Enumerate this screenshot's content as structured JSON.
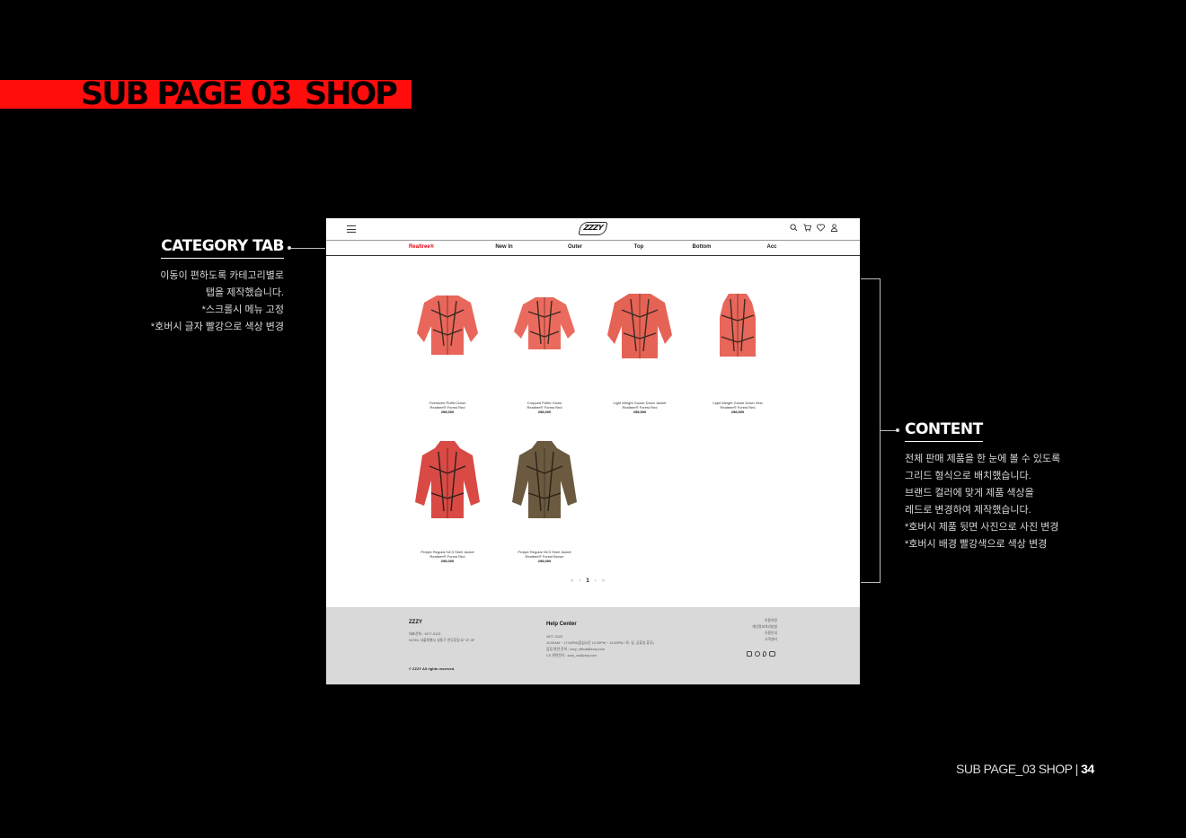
{
  "page": {
    "title": "SUB PAGE 03_SHOP",
    "footer_label": "SUB PAGE_03 SHOP",
    "separator": " | ",
    "page_number": "34",
    "accent_color": "#ff0d0d"
  },
  "annotations": {
    "category_tab": {
      "heading": "CATEGORY TAB",
      "lines": [
        "이동이 편하도록 카테고리별로",
        "탭을 제작했습니다.",
        "*스크롤시 메뉴 고정",
        "*호버시 글자 빨강으로 색상 변경"
      ]
    },
    "content": {
      "heading": "CONTENT",
      "lines": [
        "전체 판매 제품을 한 눈에 볼 수 있도록",
        "그리드 형식으로 배치했습니다.",
        "브랜드 컬러에 맞게 제품 색상을",
        "레드로 변경하여 제작했습니다.",
        "*호버시 제품 뒷면 사진으로 사진 변경",
        "*호버시 배경 빨강색으로 색상 변경"
      ]
    }
  },
  "site": {
    "logo": "ZZZY",
    "header_icons": [
      "search-icon",
      "cart-icon",
      "heart-icon",
      "user-icon"
    ],
    "categories": [
      "Realtree®",
      "New In",
      "Outer",
      "Top",
      "Bottom",
      "Acc"
    ],
    "active_category": "Realtree®",
    "active_color": "#e60012",
    "products": [
      {
        "name": "Oversized Puffer Down",
        "sub": "Realtree® Forest Red",
        "price": "298,000",
        "color": "#e8675a"
      },
      {
        "name": "Cropped Puffer Down",
        "sub": "Realtree® Forest Red",
        "price": "258,000",
        "color": "#ea6b5e"
      },
      {
        "name": "Light Weight Goose Down Jacket",
        "sub": "Realtree® Forest Red",
        "price": "258,900",
        "color": "#e56355"
      },
      {
        "name": "Light Weight Goose Down Vest",
        "sub": "Realtree® Forest Red",
        "price": "258,900",
        "color": "#e8665a"
      },
      {
        "name": "Prolyte Regular NC3 Shell Jacket",
        "sub": "Realtree® Forest Red",
        "price": "298,000",
        "color": "#d94a45"
      },
      {
        "name": "Prolyte Regular NC3 Shell Jacket",
        "sub": "Realtree® Forest Brown",
        "price": "298,000",
        "color": "#6b5a40"
      }
    ],
    "pagination": {
      "prev_first": "«",
      "prev": "‹",
      "current": "1",
      "next": "›",
      "next_last": "»"
    },
    "footer": {
      "brand": "ZZZY",
      "contact_lines": [
        "대표전화 : 1877-0123",
        "04783, 서울특별시 성동구 연무장길 87 1F-3F"
      ],
      "copyright": "© ZZZY All rights reserved.",
      "help_title": "Help Center",
      "help_lines": [
        "1877-0123",
        "11:00AM ~ 17:00PM(점심시간 12:30PM ~ 13:30PM / 토, 일, 공휴일 휴무)",
        "입점 관련 문의 : zzzy_offical@zzzy.com",
        "CS 관련문의 : zzzy_cs@zzzy.com"
      ],
      "links": [
        "이용약관",
        "개인정보처리방침",
        "이용안내",
        "고객센터"
      ],
      "socials": [
        "instagram-icon",
        "chat-icon",
        "pin-icon",
        "youtube-icon"
      ]
    }
  }
}
